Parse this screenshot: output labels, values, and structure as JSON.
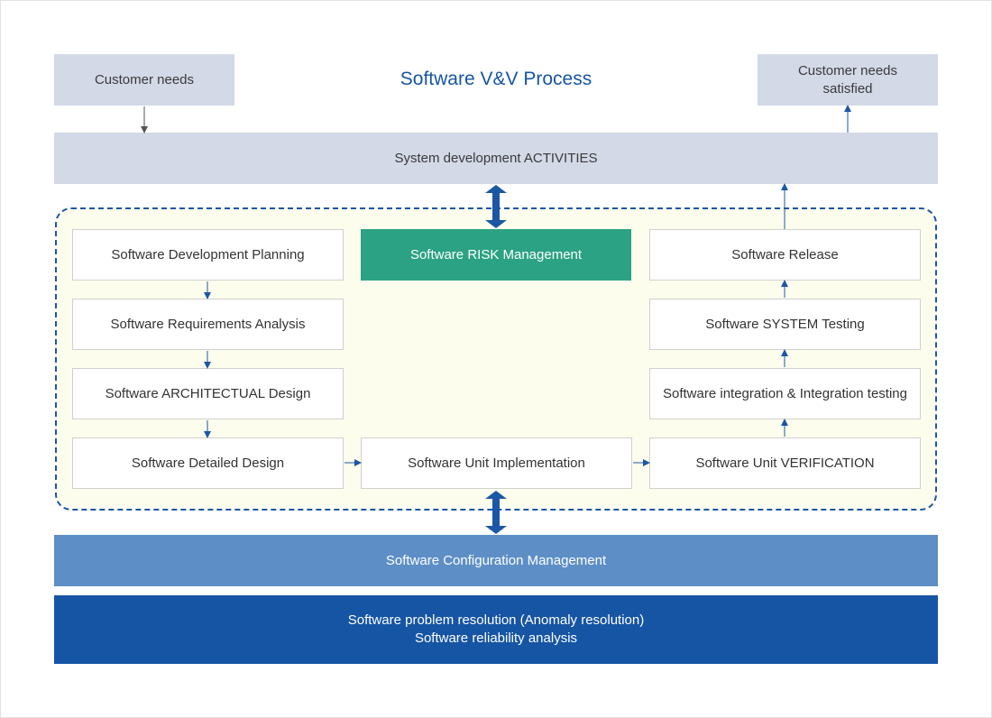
{
  "title": "Software V&V Process",
  "customer_needs": "Customer needs",
  "customer_needs_satisfied": "Customer needs\nsatisfied",
  "system_activities": "System development ACTIVITIES",
  "left_column": [
    "Software Development Planning",
    "Software Requirements Analysis",
    "Software ARCHITECTUAL Design",
    "Software Detailed Design"
  ],
  "risk_management": "Software RISK Management",
  "unit_implementation": "Software Unit Implementation",
  "right_column": [
    "Software Release",
    "Software SYSTEM Testing",
    "Software integration & Integration testing",
    "Software Unit VERIFICATION"
  ],
  "configuration_management": "Software Configuration Management",
  "problem_resolution": "Software problem resolution (Anomaly resolution)\nSoftware reliability analysis",
  "colors": {
    "title": "#1756a4",
    "gray_box": "#d3d9e7",
    "risk_box": "#2ba283",
    "config_box": "#5d8fc6",
    "problem_box": "#1655a4",
    "dashed_border": "#1b57a5",
    "region_fill": "#fdfdee",
    "arrow": "#1b57a5"
  }
}
